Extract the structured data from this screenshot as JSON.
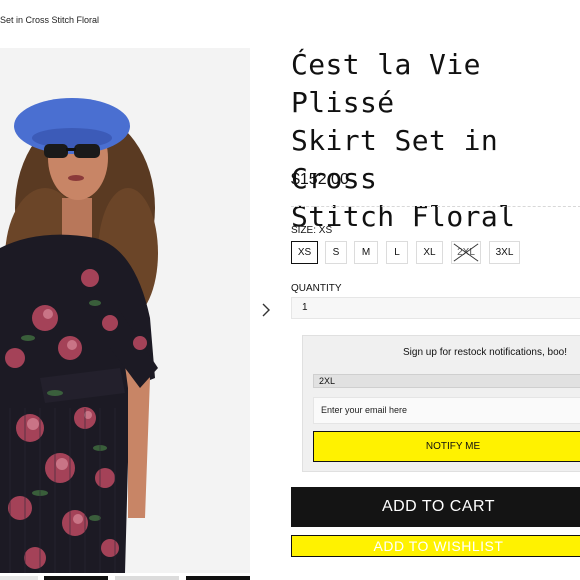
{
  "breadcrumb": {
    "text": "Set in Cross Stitch Floral"
  },
  "product": {
    "title": "Ćest la Vie Plissé\nSkirt Set in Cross\nStitch Floral",
    "price": "$152.00",
    "image_alt": "Model wearing floral plissé skirt set with blue beret"
  },
  "size": {
    "label": "SIZE: XS",
    "options": [
      {
        "label": "XS",
        "selected": true,
        "sold_out": false
      },
      {
        "label": "S",
        "selected": false,
        "sold_out": false
      },
      {
        "label": "M",
        "selected": false,
        "sold_out": false
      },
      {
        "label": "L",
        "selected": false,
        "sold_out": false
      },
      {
        "label": "XL",
        "selected": false,
        "sold_out": false
      },
      {
        "label": "2XL",
        "selected": false,
        "sold_out": true
      },
      {
        "label": "3XL",
        "selected": false,
        "sold_out": false
      }
    ]
  },
  "quantity": {
    "label": "QUANTITY",
    "value": "1"
  },
  "restock": {
    "title": "Sign up for restock notifications, boo!",
    "selected_size": "2XL",
    "email_placeholder": "Enter your email here",
    "button": "NOTIFY ME"
  },
  "actions": {
    "add_to_cart": "ADD TO CART",
    "add_to_wishlist": "ADD TO WISHLIST"
  },
  "colors": {
    "accent_yellow": "#fff200",
    "dark": "#141414"
  }
}
